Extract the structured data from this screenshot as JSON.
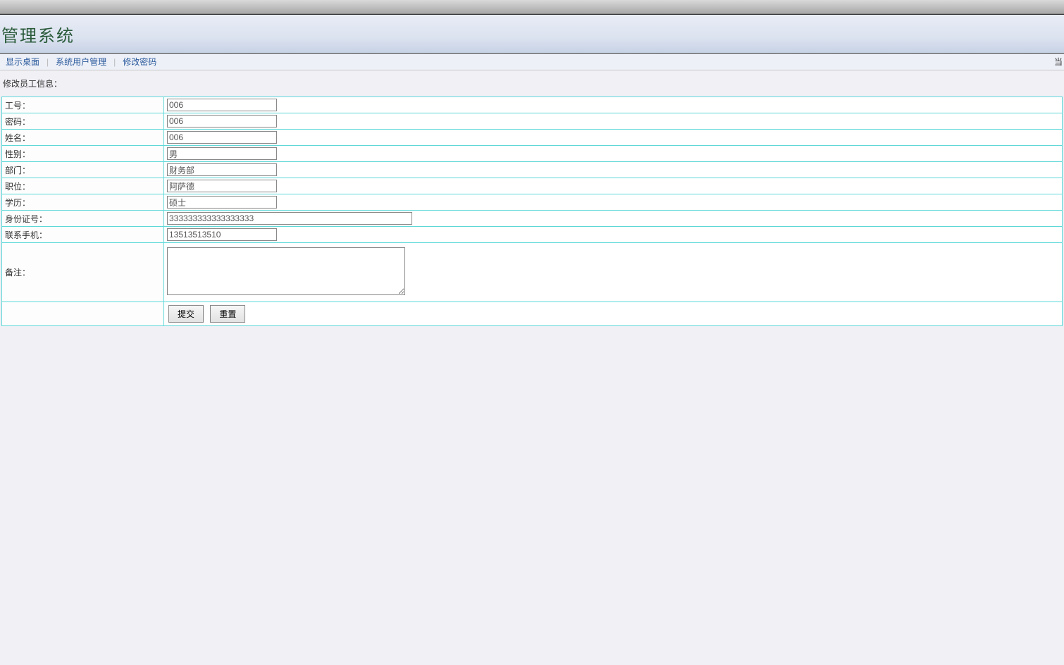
{
  "header": {
    "title": "管理系统"
  },
  "nav": {
    "link1": "显示桌面",
    "link2": "系统用户管理",
    "link3": "修改密码",
    "right_text": "当"
  },
  "form": {
    "title": "修改员工信息：",
    "labels": {
      "employee_id": "工号：",
      "password": "密码：",
      "name": "姓名：",
      "gender": "性别：",
      "department": "部门：",
      "position": "职位：",
      "education": "学历：",
      "id_number": "身份证号：",
      "phone": "联系手机：",
      "remark": "备注："
    },
    "values": {
      "employee_id": "006",
      "password": "006",
      "name": "006",
      "gender": "男",
      "department": "财务部",
      "position": "阿萨德",
      "education": "硕士",
      "id_number": "333333333333333333",
      "phone": "13513513510",
      "remark": ""
    },
    "buttons": {
      "submit": "提交",
      "reset": "重置"
    }
  }
}
